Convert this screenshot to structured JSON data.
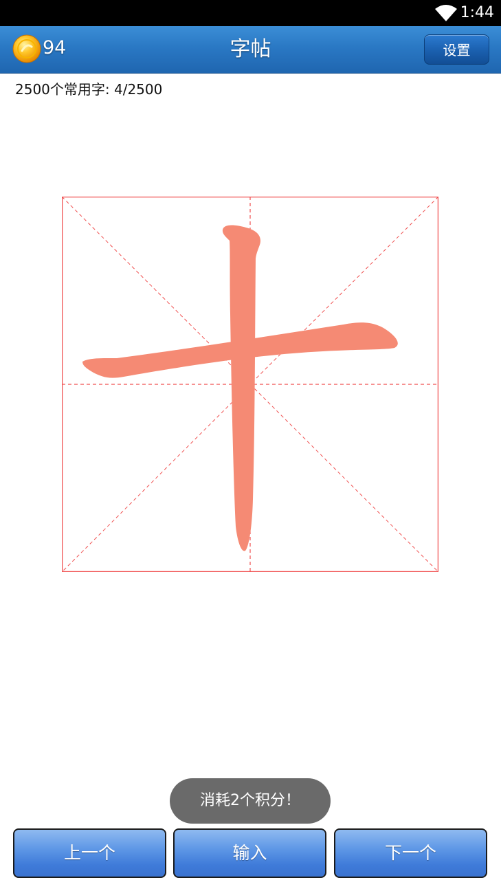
{
  "status_bar": {
    "time": "1:44",
    "wifi_icon": "wifi-icon"
  },
  "header": {
    "coin_icon": "coin-icon",
    "coin_count": "94",
    "title": "字帖",
    "settings_label": "设置"
  },
  "progress": {
    "text": "2500个常用字: 4/2500"
  },
  "practice": {
    "character": "十",
    "stroke_color": "#f58a74",
    "grid_color": "#f04040"
  },
  "toast": {
    "message": "消耗2个积分！"
  },
  "bottom_nav": {
    "prev_label": "上一个",
    "input_label": "输入",
    "next_label": "下一个"
  },
  "colors": {
    "title_bar": "#2a78c4",
    "button": "#4f88de",
    "toast_bg": "#6a6a6a"
  }
}
